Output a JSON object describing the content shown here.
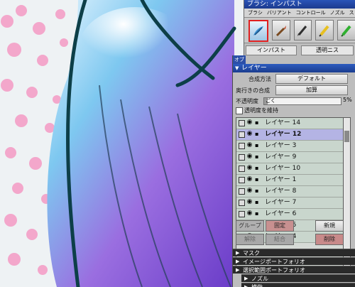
{
  "brush_window": {
    "title": "ブラシ: インパスト",
    "menu": [
      "ブラシ",
      "バリアント",
      "コントロール",
      "ノズル",
      "ストロー"
    ],
    "icons": [
      "brush-stroke-icon",
      "brush-tip-icon",
      "ink-pen-icon",
      "pencil-icon",
      "marker-icon"
    ],
    "variant_left": "インパスト",
    "variant_right": "透明ニス"
  },
  "layers_panel": {
    "side_tab": "オブ",
    "title": "レイヤー",
    "blend_label": "合成方法",
    "blend_value": "デフォルト",
    "depth_label": "奥行きの合成",
    "depth_value": "加算",
    "opacity_label": "不透明度",
    "opacity_slider_text": "ごく",
    "opacity_value": "5%",
    "opacity_fraction": 0.05,
    "preserve_label": "透明度を維持",
    "layers": [
      {
        "name": "レイヤー 14",
        "active": false
      },
      {
        "name": "レイヤー 12",
        "active": true
      },
      {
        "name": "レイヤー 3",
        "active": false
      },
      {
        "name": "レイヤー 9",
        "active": false
      },
      {
        "name": "レイヤー 10",
        "active": false
      },
      {
        "name": "レイヤー 1",
        "active": false
      },
      {
        "name": "レイヤー 8",
        "active": false
      },
      {
        "name": "レイヤー 7",
        "active": false
      },
      {
        "name": "レイヤー 6",
        "active": false
      },
      {
        "name": "レイヤー 5",
        "active": false
      },
      {
        "name": "レイヤー 4",
        "active": false
      }
    ],
    "buttons": {
      "group": "グループ",
      "fix": "固定",
      "new": "新規",
      "release": "解除",
      "merge": "結合",
      "delete": "削除"
    },
    "sections": [
      "マスク",
      "イメージポートフォリオ",
      "選択範囲ポートフォリオ"
    ],
    "sub_sections": [
      "ノズル",
      "模倣"
    ]
  },
  "colors": {
    "titlebar": "#2a54b8",
    "active_layer": "#b4b4e4",
    "delete_button": "#c88a8a"
  }
}
